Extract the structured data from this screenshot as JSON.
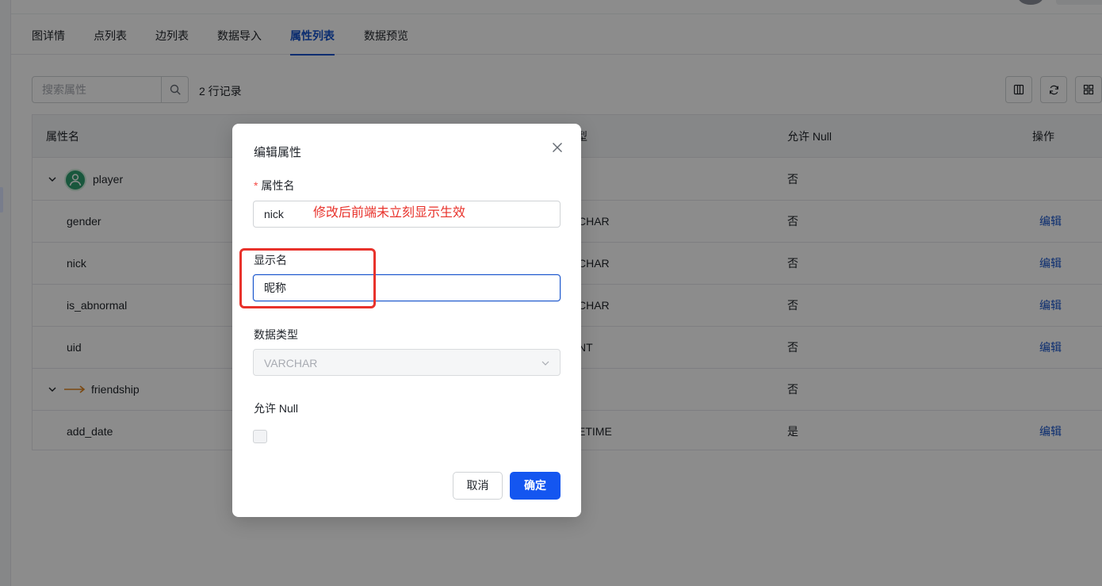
{
  "tabs": [
    {
      "label": "图详情",
      "active": false
    },
    {
      "label": "点列表",
      "active": false
    },
    {
      "label": "边列表",
      "active": false
    },
    {
      "label": "数据导入",
      "active": false
    },
    {
      "label": "属性列表",
      "active": true
    },
    {
      "label": "数据预览",
      "active": false
    }
  ],
  "toolbar": {
    "search_placeholder": "搜索属性",
    "record_count": "2 行记录"
  },
  "table": {
    "headers": {
      "name": "属性名",
      "type": "型",
      "nullable": "允许 Null",
      "actions": "操作"
    },
    "rows": [
      {
        "name": "player",
        "type": "",
        "nullable": "否",
        "action": ""
      },
      {
        "name": "gender",
        "type": "CHAR",
        "nullable": "否",
        "action": "编辑"
      },
      {
        "name": "nick",
        "type": "CHAR",
        "nullable": "否",
        "action": "编辑"
      },
      {
        "name": "is_abnormal",
        "type": "CHAR",
        "nullable": "否",
        "action": "编辑"
      },
      {
        "name": "uid",
        "type": "NT",
        "nullable": "否",
        "action": "编辑"
      },
      {
        "name": "friendship",
        "type": "",
        "nullable": "否",
        "action": ""
      },
      {
        "name": "add_date",
        "type": "ETIME",
        "nullable": "是",
        "action": "编辑"
      }
    ]
  },
  "modal": {
    "title": "编辑属性",
    "required_mark": "*",
    "name_label": "属性名",
    "name_value": "nick",
    "display_label": "显示名",
    "display_value": "昵称",
    "type_label": "数据类型",
    "type_value": "VARCHAR",
    "nullable_label": "允许 Null",
    "nullable_checked": false,
    "cancel_label": "取消",
    "ok_label": "确定"
  },
  "annotation": {
    "text": "修改后前端未立刻显示生效",
    "color": "#e8322b"
  },
  "colors": {
    "primary": "#1452cc",
    "primary_button": "#1456f0",
    "player_icon": "#2f9e6f",
    "edge_arrow": "#e0841f"
  },
  "icons": [
    "search-icon",
    "column-settings-icon",
    "refresh-icon",
    "grid-icon",
    "chevron-down-icon",
    "user-icon",
    "arrow-right-icon",
    "close-icon"
  ]
}
